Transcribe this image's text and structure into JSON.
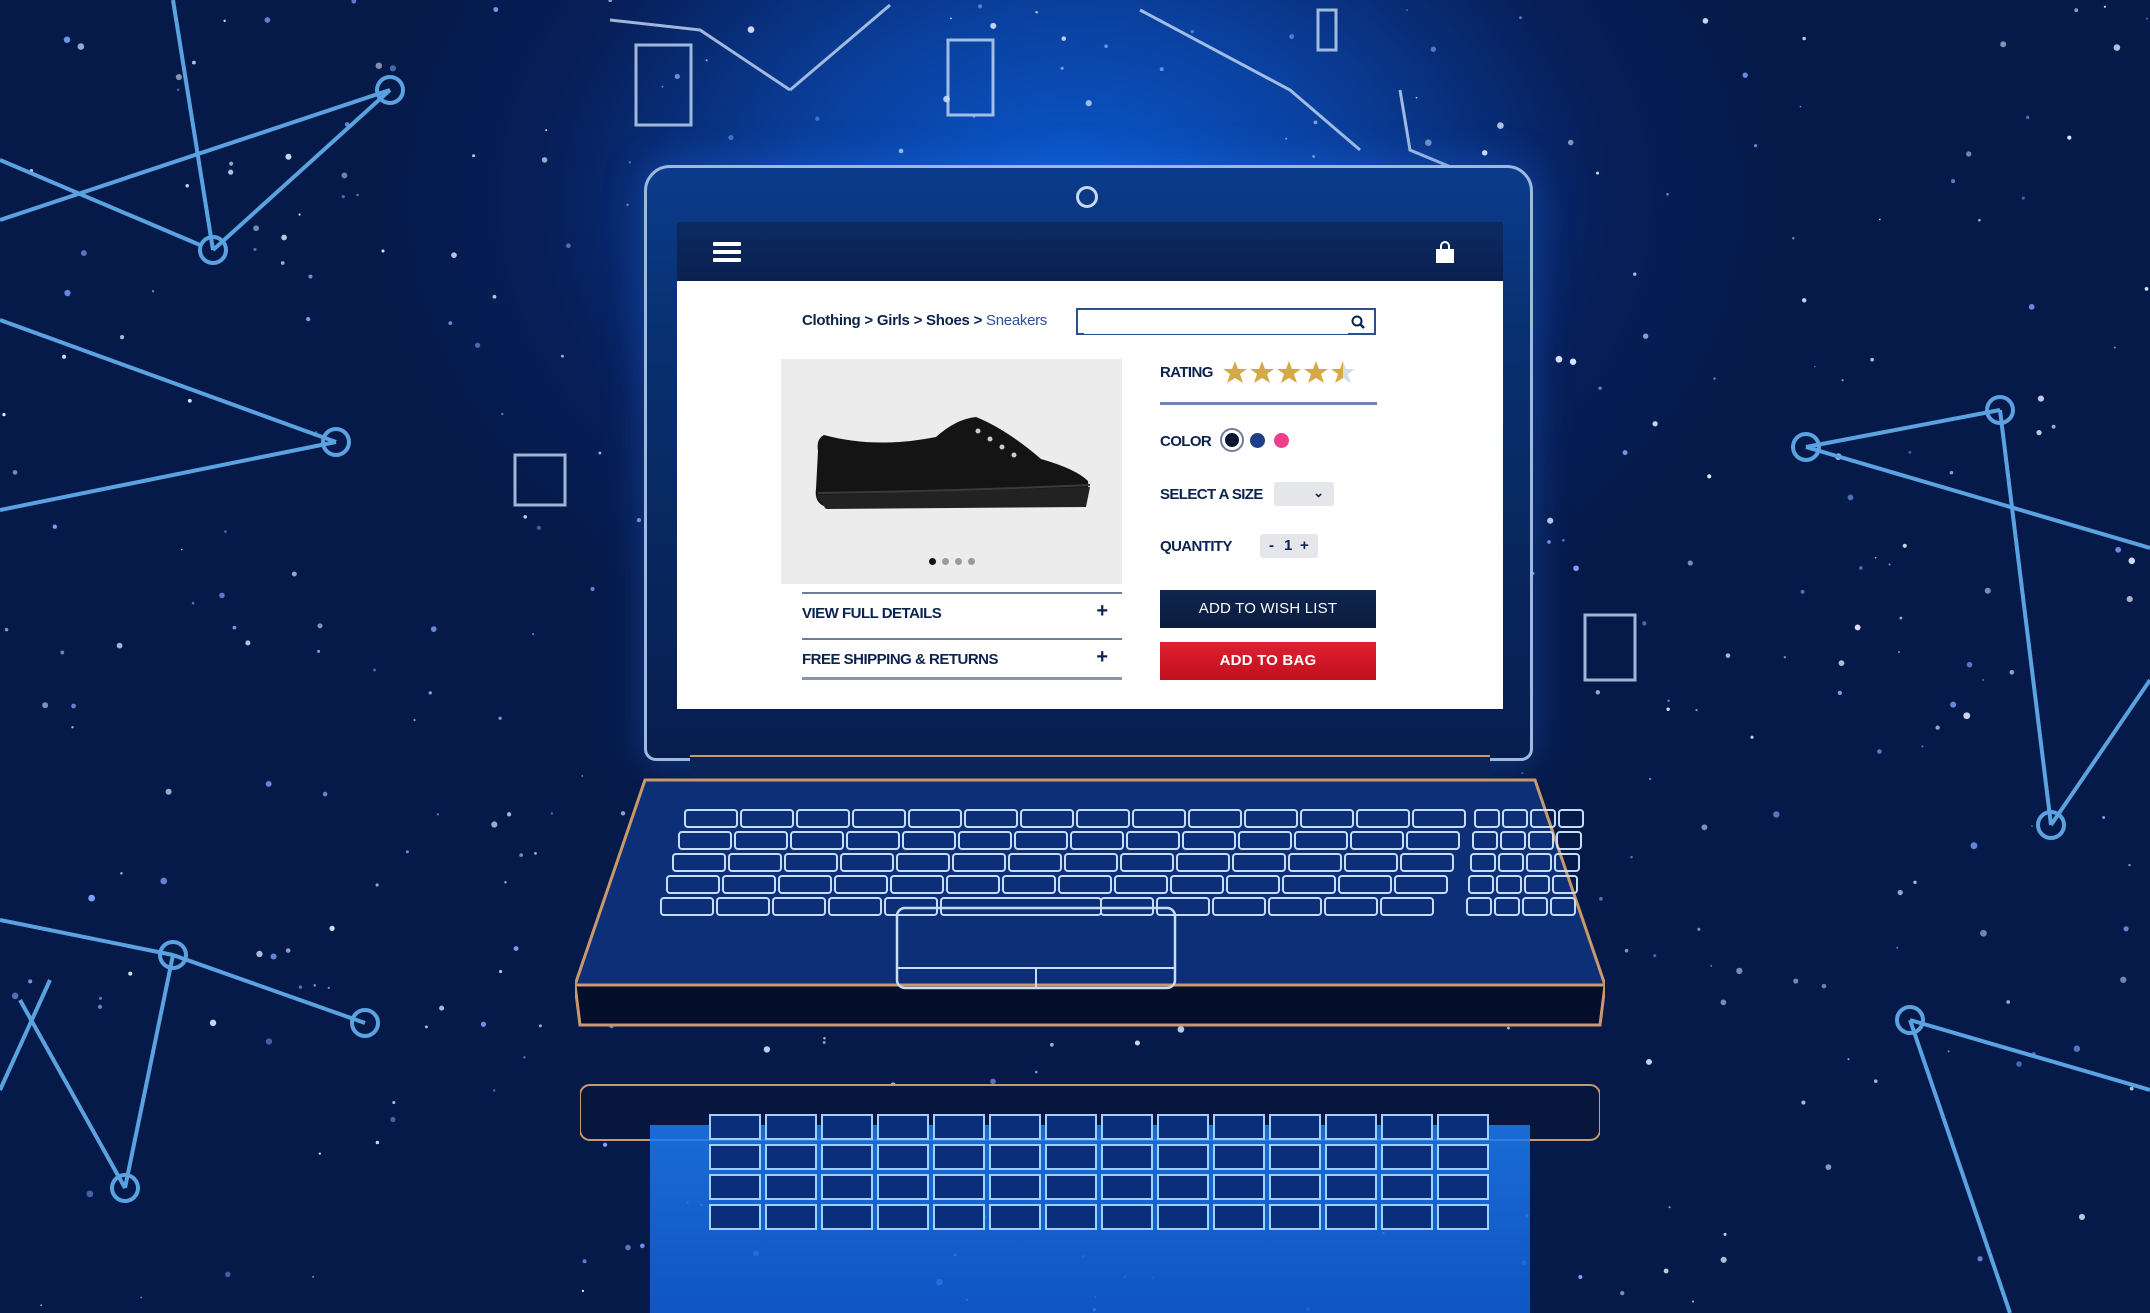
{
  "scene": {
    "background_color": "#071f5a",
    "line_color": "#5aa2e0",
    "laptop_outline_color": "#c9996b"
  },
  "header": {
    "menu_icon": "hamburger-menu-icon",
    "cart_icon": "shopping-bag-icon",
    "background": "#0c2a60"
  },
  "breadcrumb": {
    "items": [
      "Clothing",
      "Girls",
      "Shoes",
      "Sneakers"
    ],
    "separator": ">"
  },
  "search": {
    "value": "",
    "placeholder": "",
    "icon": "search-icon"
  },
  "gallery": {
    "image": "black canvas sneaker",
    "dot_count": 4,
    "active_index": 0
  },
  "accordion": [
    {
      "label": "VIEW FULL DETAILS",
      "toggle": "+"
    },
    {
      "label": "FREE SHIPPING & RETURNS",
      "toggle": "+"
    }
  ],
  "product": {
    "rating_label": "RATING",
    "rating_value": 4.5,
    "rating_max": 5,
    "star_color": "#d4a94a",
    "color_label": "COLOR",
    "colors": [
      {
        "name": "black",
        "hex": "#0b1530",
        "selected": true
      },
      {
        "name": "navy",
        "hex": "#1c3f86",
        "selected": false
      },
      {
        "name": "pink",
        "hex": "#ee3f8c",
        "selected": false
      }
    ],
    "size_label": "SELECT A SIZE",
    "size_value": "",
    "quantity_label": "QUANTITY",
    "quantity_minus": "-",
    "quantity_value": "1",
    "quantity_plus": "+"
  },
  "buttons": {
    "wish_list": "ADD TO WISH LIST",
    "add_to_bag": "ADD TO BAG",
    "wish_color": "#0f2650",
    "bag_color": "#d81a28"
  }
}
